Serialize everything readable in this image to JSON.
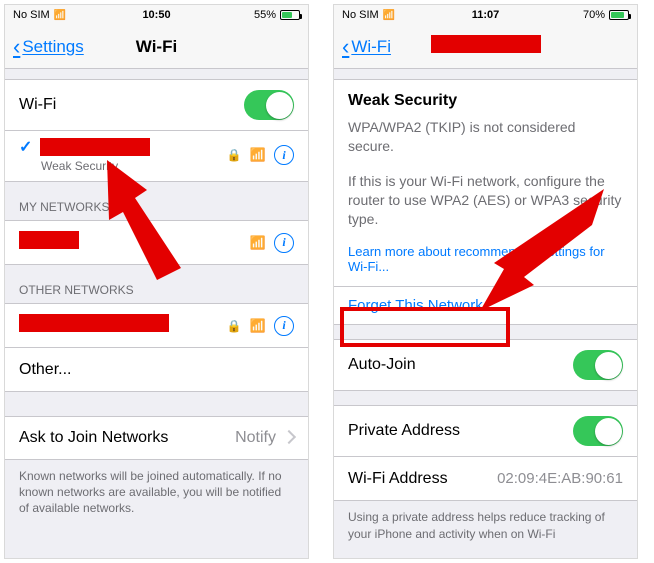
{
  "left": {
    "status": {
      "carrier": "No SIM",
      "time": "10:50",
      "battery_pct": "55%",
      "battery_fill": 55
    },
    "nav": {
      "back": "Settings",
      "title": "Wi-Fi"
    },
    "wifi_toggle_label": "Wi-Fi",
    "connected": {
      "sub": "Weak Security"
    },
    "my_networks_header": "MY NETWORKS",
    "other_networks_header": "OTHER NETWORKS",
    "other_label": "Other...",
    "ask_label": "Ask to Join Networks",
    "ask_value": "Notify",
    "ask_footer": "Known networks will be joined automatically. If no known networks are available, you will be notified of available networks."
  },
  "right": {
    "status": {
      "carrier": "No SIM",
      "time": "11:07",
      "battery_pct": "70%",
      "battery_fill": 70
    },
    "nav": {
      "back": "Wi-Fi"
    },
    "weak_title": "Weak Security",
    "weak_para1": "WPA/WPA2 (TKIP) is not considered secure.",
    "weak_para2": "If this is your Wi-Fi network, configure the router to use WPA2 (AES) or WPA3 security type.",
    "learn_more": "Learn more about recommended settings for Wi-Fi...",
    "forget": "Forget This Network",
    "auto_join": "Auto-Join",
    "private_addr": "Private Address",
    "wifi_addr_label": "Wi-Fi Address",
    "wifi_addr_value": "02:09:4E:AB:90:61",
    "private_footer": "Using a private address helps reduce tracking of your iPhone and activity when on Wi-Fi"
  }
}
